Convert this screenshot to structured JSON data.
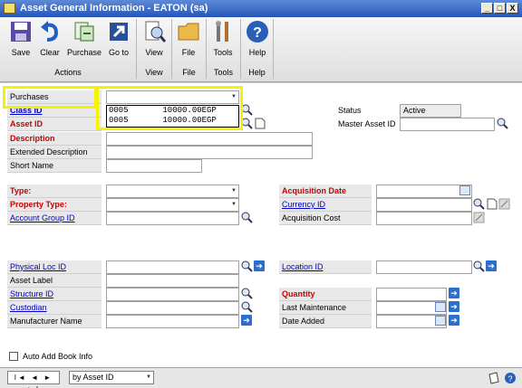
{
  "window": {
    "title": "Asset General Information  -  EATON (sa)",
    "minimize": "_",
    "restore": "□",
    "close": "X"
  },
  "ribbon": {
    "buttons": [
      {
        "label": "Save",
        "icon": "save-icon"
      },
      {
        "label": "Clear",
        "icon": "undo-icon"
      },
      {
        "label": "Purchase",
        "icon": "purchase-icon"
      },
      {
        "label": "Go to",
        "icon": "goto-icon"
      },
      {
        "label": "View",
        "icon": "view-icon"
      },
      {
        "label": "File",
        "icon": "folder-icon"
      },
      {
        "label": "Tools",
        "icon": "tools-icon"
      },
      {
        "label": "Help",
        "icon": "help-icon"
      }
    ],
    "groups": [
      "Actions",
      "View",
      "File",
      "Tools",
      "Help"
    ]
  },
  "form": {
    "purchases_label": "Purchases",
    "purchases_value": "",
    "dropdown_rows": [
      "0005       10000.00EGP",
      "0005       10000.00EGP"
    ],
    "class_id_label": "Class ID",
    "asset_id_label": "Asset ID",
    "description_label": "Description",
    "extended_description_label": "Extended Description",
    "short_name_label": "Short Name",
    "status_label": "Status",
    "status_value": "Active",
    "master_asset_id_label": "Master Asset ID",
    "type_label": "Type:",
    "property_type_label": "Property Type:",
    "account_group_id_label": "Account Group ID",
    "acquisition_date_label": "Acquisition Date",
    "currency_id_label": "Currency ID",
    "acquisition_cost_label": "Acquisition Cost",
    "physical_loc_id_label": "Physical Loc ID",
    "asset_label_label": "Asset Label",
    "structure_id_label": "Structure ID",
    "custodian_label": "Custodian",
    "manufacturer_name_label": "Manufacturer Name",
    "location_id_label": "Location ID",
    "quantity_label": "Quantity",
    "last_maintenance_label": "Last Maintenance",
    "date_added_label": "Date Added",
    "auto_add_book_info_label": "Auto Add Book Info"
  },
  "bottom": {
    "nav_glyphs": "I◄ ◄ ► ►I",
    "sort_value": "by Asset ID"
  },
  "colors": {
    "required": "#cc0000",
    "link": "#0000cc",
    "highlight": "#f4f400",
    "titlebar": "#2456b8"
  }
}
